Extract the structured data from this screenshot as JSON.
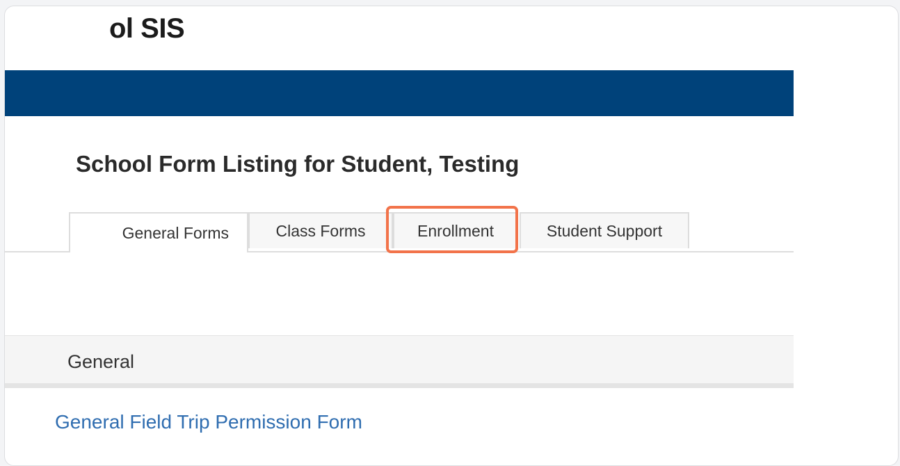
{
  "header": {
    "app_title": "ol SIS"
  },
  "page": {
    "heading": "School Form Listing for Student, Testing"
  },
  "tabs": [
    {
      "label": "General Forms",
      "active": true
    },
    {
      "label": "Class Forms",
      "active": false
    },
    {
      "label": "Enrollment",
      "active": false,
      "highlighted": true
    },
    {
      "label": "Student Support",
      "active": false
    }
  ],
  "panel": {
    "title": "General",
    "forms": [
      {
        "label": "General Field Trip Permission Form"
      }
    ]
  },
  "colors": {
    "navbar": "#00427a",
    "link": "#2f6db0",
    "highlight": "#f2734a"
  }
}
